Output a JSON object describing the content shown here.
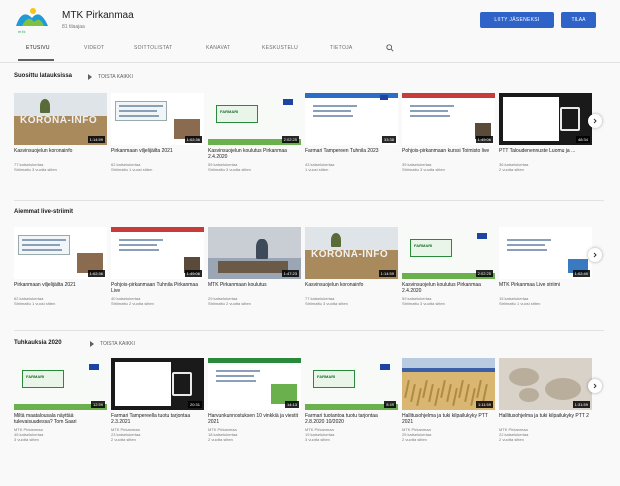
{
  "colors": {
    "accent": "#2f63c8",
    "background": "#f9f9f9"
  },
  "channel": {
    "name": "MTK Pirkanmaa",
    "subscribers": "81 tilaajaa",
    "logo_text": "mtk",
    "join_label": "Liity jäseneksi",
    "subscribe_label": "Tilaa"
  },
  "tabs": [
    {
      "label": "Etusivu",
      "active": true
    },
    {
      "label": "Videot",
      "active": false
    },
    {
      "label": "Soittolistat",
      "active": false
    },
    {
      "label": "Kanavat",
      "active": false
    },
    {
      "label": "Keskustelu",
      "active": false
    },
    {
      "label": "Tietoja",
      "active": false
    }
  ],
  "search_icon": "search-icon",
  "sections": [
    {
      "title": "Suosittu latauksissa",
      "play_all": "Toista kaikki",
      "videos": [
        {
          "title": "Kasvinsuojelun koronainfo",
          "duration": "1:14:59",
          "meta": [
            "77 katselukertaa",
            "Striimattu 3 vuotta sitten"
          ],
          "thumb": "field"
        },
        {
          "title": "Pirkanmaan viljelijäilta 2021",
          "duration": "1:02:36",
          "meta": [
            "62 katselukertaa",
            "Striimattu 1 vuosi sitten"
          ],
          "thumb": "slide"
        },
        {
          "title": "Kasvinsuojelun koulutus Pirkanmaa 2.4.2020",
          "duration": "2:02:25",
          "meta": [
            "59 katselukertaa",
            "Striimattu 3 vuotta sitten"
          ],
          "thumb": "green"
        },
        {
          "title": "Farmari Tampereen Tuhnila 2023",
          "duration": "33:38",
          "meta": [
            "43 katselukertaa",
            "1 vuosi sitten"
          ],
          "thumb": "slide2"
        },
        {
          "title": "Pohjois-pirkanmaan kurssi Toimisto live",
          "duration": "1:49:06",
          "meta": [
            "39 katselukertaa",
            "Striimattu 3 vuotta sitten"
          ],
          "thumb": "slide3"
        },
        {
          "title": "PTT Taloudenennuste Luomu ja ...",
          "duration": "48:34",
          "meta": [
            "36 katselukertaa",
            "2 vuotta sitten"
          ],
          "thumb": "dark"
        }
      ]
    },
    {
      "title": "Aiemmat live-striimit",
      "play_all": "",
      "videos": [
        {
          "title": "Pirkanmaan viljelijäilta 2021",
          "duration": "1:02:36",
          "meta": [
            "62 katselukertaa",
            "Striimattu 1 vuosi sitten"
          ],
          "thumb": "slide"
        },
        {
          "title": "Pohjois-pirkanmaan Tuhnila Pirkanmaa Live",
          "duration": "1:49:06",
          "meta": [
            "40 katselukertaa",
            "Striimattu 2 vuotta sitten"
          ],
          "thumb": "slide3"
        },
        {
          "title": "MTK Pirkanmaan koulutus",
          "duration": "1:47:23",
          "meta": [
            "29 katselukertaa",
            "Striimattu 2 vuotta sitten"
          ],
          "thumb": "room"
        },
        {
          "title": "Kasvinsuojelun koronainfo",
          "duration": "1:14:59",
          "meta": [
            "77 katselukertaa",
            "Striimattu 3 vuotta sitten"
          ],
          "thumb": "field"
        },
        {
          "title": "Kasvinsuojelun koulutus Pirkanmaa 2.4.2020",
          "duration": "2:02:25",
          "meta": [
            "59 katselukertaa",
            "Striimattu 3 vuotta sitten"
          ],
          "thumb": "green"
        },
        {
          "title": "MTK Pirkanmaa Live striimi",
          "duration": "1:02:40",
          "meta": [
            "15 katselukertaa",
            "Striimattu 1 vuosi sitten"
          ],
          "thumb": "slide4"
        }
      ]
    },
    {
      "title": "Tuhkauksia 2020",
      "play_all": "Toista kaikki",
      "videos": [
        {
          "title": "Miltä maatalousala näyttää tulevaisuudessa? Tom Saari",
          "duration": "12:59",
          "meta": [
            "MTK Pirkanmaa",
            "45 katselukertaa",
            "3 vuotta sitten"
          ],
          "thumb": "green2"
        },
        {
          "title": "Farmari Tampereella tuotu tarjontaa 2.3.2021",
          "duration": "20:31",
          "meta": [
            "MTK Pirkanmaa",
            "23 katselukertaa",
            "2 vuotta sitten"
          ],
          "thumb": "dark2"
        },
        {
          "title": "Harvunkunnostuksen 10 vinkkiä ja viestit 2021",
          "duration": "14:13",
          "meta": [
            "MTK Pirkanmaa",
            "18 katselukertaa",
            "2 vuotta sitten"
          ],
          "thumb": "slide5"
        },
        {
          "title": "Farmari tuotantoa tuotu tarjontaa 2.8.2020 10/2020",
          "duration": "8:49",
          "meta": [
            "MTK Pirkanmaa",
            "19 katselukertaa",
            "3 vuotta sitten"
          ],
          "thumb": "green3"
        },
        {
          "title": "Hallitusohjelma ja tuki kilpailukyky PTT 2021",
          "duration": "1:11:59",
          "meta": [
            "MTK Pirkanmaa",
            "25 katselukertaa",
            "2 vuotta sitten"
          ],
          "thumb": "wheat"
        },
        {
          "title": "Hallitusohjelma ja tuki kilpailukyky PTT 2",
          "duration": "1:31:59",
          "meta": [
            "MTK Pirkanmaa",
            "22 katselukertaa",
            "2 vuotta sitten"
          ],
          "thumb": "stone"
        }
      ]
    }
  ]
}
